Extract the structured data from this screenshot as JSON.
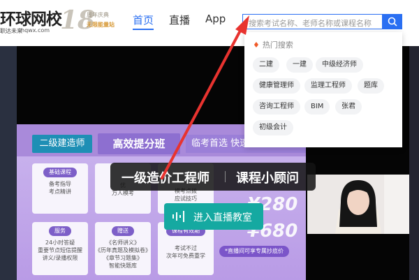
{
  "header": {
    "logo_text": "环球网校",
    "logo_slogan": "职达未来",
    "logo_url": "hqwx.com",
    "anniversary_number": "18",
    "anniversary_line1": "周年庆典",
    "anniversary_line2": "无限能量站"
  },
  "nav": {
    "home": "首页",
    "live": "直播",
    "app": "App"
  },
  "search": {
    "placeholder": "搜索考试名称、老师名称或课程名称",
    "hot_title": "热门搜索",
    "tags": [
      "二建",
      "一建",
      "中级经济师",
      "健康管理师",
      "监理工程师",
      "题库",
      "咨询工程师",
      "BIM",
      "张君",
      "初级会计"
    ]
  },
  "slide": {
    "pill_left": "二级建造师",
    "pill_center": "高效提分班",
    "pill_right": "临考首选 快速提分",
    "cards": [
      {
        "badge": "基础课程",
        "text": "备考指导\n考点精讲"
      },
      {
        "badge": "",
        "text": "优\n万人模考"
      },
      {
        "badge": "",
        "text": "模考点拨\n应试技巧\n易错题"
      },
      {
        "badge": "服务",
        "text": "24小时答疑\n重要节点短信提醒\n讲义/录播权限"
      },
      {
        "badge": "赠送",
        "text": "《名师讲义》\n《历年真题及模拟卷》\n《章节习题集》\n智能快题库"
      },
      {
        "badge": "课程有效期",
        "text": "考试不过\n次年可免费重学"
      }
    ],
    "price1": "¥280",
    "price2": "¥680",
    "price_note": "*直播间可享专属抄底价"
  },
  "banner": {
    "left": "一级造价工程师",
    "right": "课程小顾问"
  },
  "live_button": {
    "label": "进入直播教室"
  },
  "colors": {
    "accent": "#2a6ff2",
    "teal": "#15a9a1",
    "purple": "#b99be6",
    "arrow": "#e8332f"
  }
}
